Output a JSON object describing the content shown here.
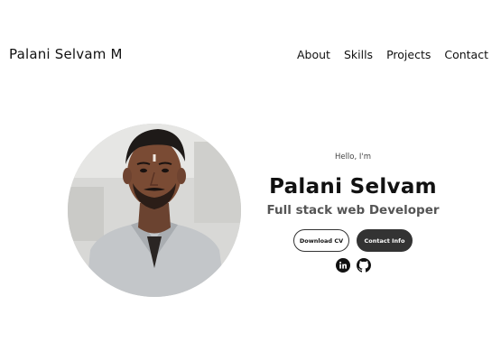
{
  "header": {
    "logo_text": "Palani Selvam M",
    "nav": [
      {
        "label": "About"
      },
      {
        "label": "Skills"
      },
      {
        "label": "Projects"
      },
      {
        "label": "Contact"
      }
    ]
  },
  "hero": {
    "greeting": "Hello, I'm",
    "name": "Palani Selvam",
    "role": "Full stack web Developer",
    "buttons": {
      "download": "Download CV",
      "contact": "Contact Info"
    },
    "socials": [
      {
        "icon": "linkedin-icon"
      },
      {
        "icon": "github-icon"
      }
    ]
  },
  "colors": {
    "text": "#111111",
    "muted": "#555555",
    "button_dark": "#333333",
    "background": "#ffffff"
  }
}
